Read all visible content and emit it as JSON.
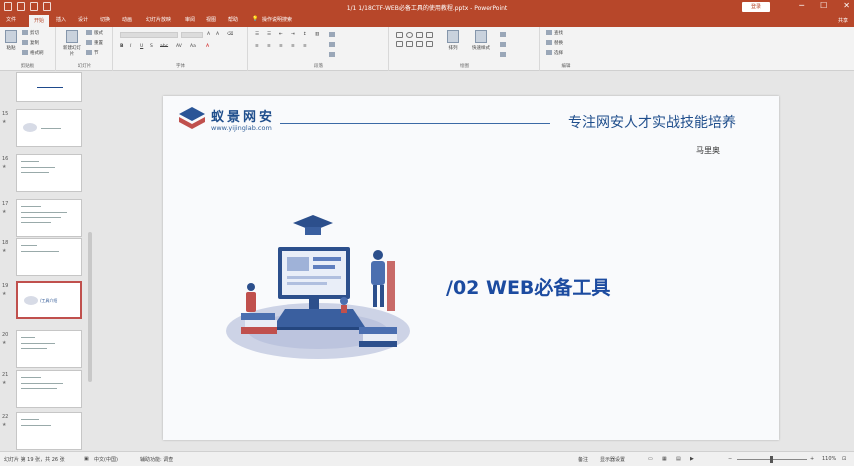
{
  "window": {
    "title": "1/1 1/18CTF-WEB必备工具的使用教程.pptx - PowerPoint",
    "login_label": "登录",
    "controls": [
      "─",
      "☐",
      "✕"
    ]
  },
  "tabs": {
    "items": [
      "文件",
      "开始",
      "插入",
      "设计",
      "切换",
      "动画",
      "幻灯片放映",
      "审阅",
      "视图",
      "帮助",
      "操作说明搜索"
    ],
    "active_index": 1,
    "share_label": "共享"
  },
  "ribbon": {
    "clipboard": {
      "paste": "粘贴",
      "cut": "剪切",
      "copy": "复制",
      "format_painter": "格式刷",
      "label": "剪贴板"
    },
    "slides": {
      "new_slide": "新建幻灯片",
      "layout": "版式",
      "reset": "重置",
      "section": "节",
      "label": "幻灯片"
    },
    "font": {
      "label": "字体"
    },
    "paragraph": {
      "label": "段落"
    },
    "drawing": {
      "arrange": "排列",
      "quick_styles": "快速样式",
      "label": "绘图"
    },
    "editing": {
      "find": "查找",
      "replace": "替换",
      "select": "选择",
      "label": "编辑"
    }
  },
  "slide_panel": {
    "thumbnails": [
      {
        "number": "",
        "selected": false
      },
      {
        "number": "15",
        "selected": false
      },
      {
        "number": "16",
        "selected": false
      },
      {
        "number": "17",
        "selected": false
      },
      {
        "number": "18",
        "selected": false
      },
      {
        "number": "19",
        "selected": true,
        "label": "/工具介绍"
      },
      {
        "number": "20",
        "selected": false
      },
      {
        "number": "21",
        "selected": false
      },
      {
        "number": "22",
        "selected": false
      }
    ]
  },
  "slide": {
    "brand_name": "蚁景网安",
    "brand_url": "www.yijinglab.com",
    "tagline": "专注网安人才实战技能培养",
    "author": "马里奥",
    "headline": "/02 WEB必备工具"
  },
  "status_bar": {
    "slide_position": "幻灯片 第 19 张，共 26 张",
    "language": "中文(中国)",
    "accessibility": "辅助功能: 调查",
    "notes": "备注",
    "display_settings": "显示器设置",
    "zoom": "110%"
  },
  "colors": {
    "accent": "#b7472a",
    "brand_blue": "#1f4e8c",
    "selected_border": "#c0504d"
  }
}
